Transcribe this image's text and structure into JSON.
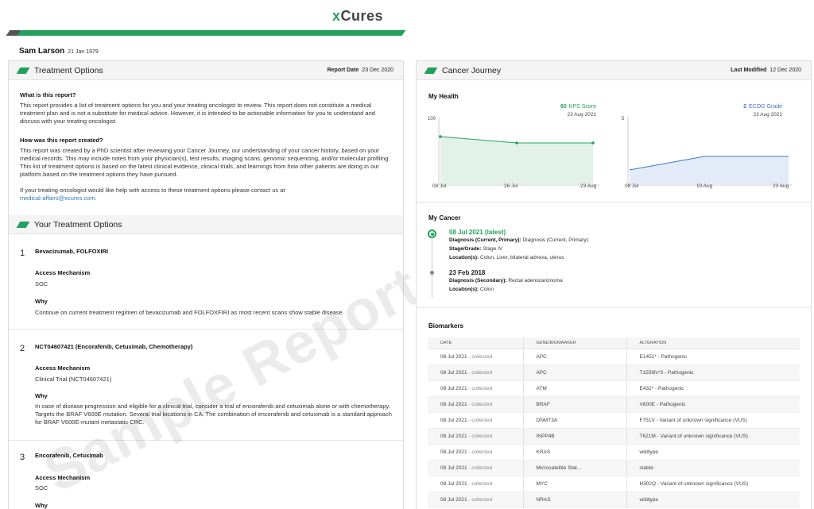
{
  "brand": {
    "logo_x": "x",
    "logo_rest": "Cures",
    "accent": "#23a05b"
  },
  "patient": {
    "name": "Sam Larson",
    "dob": "21 Jan 1979"
  },
  "left": {
    "title": "Treatment Options",
    "report_date_label": "Report Date",
    "report_date": "23 Dec 2020",
    "q1": "What is this report?",
    "a1": "This report provides a list of treatment options for you and your treating oncologist to review. This report does not constitute a medical treatment plan and is not a substitute for medical advice. However, it is intended to be actionable information for you to understand and discuss with your treating oncologist.",
    "q2": "How was this report created?",
    "a2": "This report was created by a PhD scientist after reviewing your Cancer Journey, our understanding of your cancer history, based on your medical records. This may include notes from your physician(s), test results, imaging scans, genomic sequencing, and/or molecular profiling. This list of treatment options is based on the latest clinical evidence, clinical trials, and learnings from how other patients are doing in our platform based on the treatment options they have pursued.",
    "contact": "If your treating oncologist would like help with access to these treatment options please contact us at",
    "email": "medical-affairs@xcures.com.",
    "your_options_title": "Your Treatment Options",
    "access_label": "Access Mechanism",
    "why_label": "Why",
    "treatments": [
      {
        "num": "1",
        "name": "Bevacizumab, FOLFOXIRI",
        "access": "SOC",
        "why": "Continue on current treatment regimen of bevacizumab and FOLFOXFIRI as most recent scans show stable disease."
      },
      {
        "num": "2",
        "name": "NCT04607421 (Encorafenib, Cetuximab, Chemotherapy)",
        "access": "Clinical Trial (NCT04607421)",
        "why": "In case of disease progression and eligible for a clinical trial, consider a trial of encorafenib and cetuximab alone or with chemotherapy. Targets the BRAF V600E mutation. Several trial locations in CA. The combination of encorafenib and cetuximab is a standard approach for BRAF V600E-mutant metastatic CRC."
      },
      {
        "num": "3",
        "name": "Encorafenib, Cetuximab",
        "access": "SOC",
        "why": ""
      }
    ],
    "watermark": "Sample Report"
  },
  "right": {
    "title": "Cancer Journey",
    "modified_label": "Last Modified",
    "modified_date": "12 Dec 2020",
    "health_title": "My Health",
    "kps": {
      "value": "60",
      "label": "KPS Score",
      "date": "23 Aug 2021",
      "ymax": "100",
      "x_ticks": [
        "08 Jul",
        "26 Jul",
        "23 Aug"
      ]
    },
    "ecog": {
      "value": "2",
      "label": "ECOG Grade",
      "date": "23 Aug 2021",
      "ymax": "5",
      "x_ticks": [
        "08 Jul",
        "10 Aug",
        "23 Aug"
      ]
    },
    "cancer_title": "My Cancer",
    "events": [
      {
        "date": "08 Jul 2021 (latest)",
        "lines": [
          {
            "k": "Diagnosis (Current, Primary):",
            "v": " Diagnosis (Current, Primary):"
          },
          {
            "k": "Stage/Grade:",
            "v": " Stage IV"
          },
          {
            "k": "Location(s):",
            "v": " Colon, Liver, bilateral adnexa, uterus"
          }
        ]
      },
      {
        "date": "23 Feb 2018",
        "lines": [
          {
            "k": "Diagnosis (Secondary):",
            "v": " Rectal adenocarcinoma"
          },
          {
            "k": "Location(s):",
            "v": " Colon"
          }
        ]
      }
    ],
    "bio_title": "Biomarkers",
    "bio_headers": [
      "DATE",
      "GENE/BIOMARKER",
      "ALTERATION"
    ],
    "bio_rows": [
      [
        "08 Jul 2021",
        "APC",
        "E1451* - Pathogenic"
      ],
      [
        "08 Jul 2021",
        "APC",
        "T1556fs*3 - Pathogenic"
      ],
      [
        "08 Jul 2021",
        "ATM",
        "E431* - Pathogenic"
      ],
      [
        "08 Jul 2021",
        "BRAF",
        "V600E - Pathogenic"
      ],
      [
        "08 Jul 2021",
        "DNMT3A",
        "F751V - Variant of unknown significance (VUS)"
      ],
      [
        "08 Jul 2021",
        "INPP4B",
        "T621M - Variant of unknown significance (VUS)"
      ],
      [
        "08 Jul 2021",
        "KRAS",
        "wildtype"
      ],
      [
        "08 Jul 2021",
        "Microsatellite Stat...",
        "stable"
      ],
      [
        "08 Jul 2021",
        "MYC",
        "H302Q - Variant of unknown significance (VUS)"
      ],
      [
        "08 Jul 2021",
        "NRAS",
        "wildtype"
      ]
    ],
    "collected": " - collected"
  }
}
